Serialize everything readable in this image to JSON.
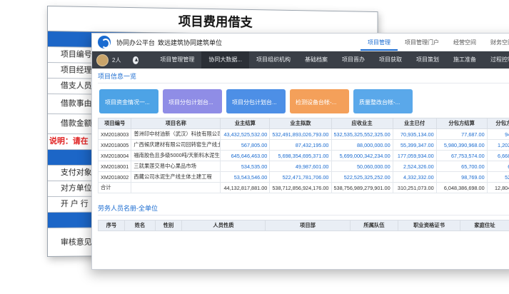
{
  "bg_form": {
    "title": "项目费用借支",
    "top_blue_label": "基本信息",
    "rows_top": [
      "项目编号",
      "项目经理",
      "借支人员",
      "借款事由",
      "借款金额"
    ],
    "note": "说明：请在",
    "rows_bottom": [
      "支付对象",
      "对方单位",
      "开 户 行"
    ],
    "review": "审核意见"
  },
  "window": {
    "app_name": "协同办公平台",
    "org_name": "致远建筑协同建筑单位",
    "top_tabs": [
      "项目管理",
      "项目管理门户",
      "经营空间",
      "财务空间"
    ],
    "user_count": "2人",
    "nav_items": [
      "项目管理管理",
      "协同大数据...",
      "项目组织机构",
      "基础档案",
      "项目晋办",
      "项目获取",
      "项目策划",
      "施工准备",
      "过程控制"
    ],
    "section1_title": "项目信息一览",
    "cards": [
      {
        "label": "项目资金情况一...",
        "color": "#4da3e6"
      },
      {
        "label": "项目分包计划台...",
        "color": "#8f8de6"
      },
      {
        "label": "项目分包计划台...",
        "color": "#4d8fe6"
      },
      {
        "label": "检测设备台帐-...",
        "color": "#f4a05a"
      },
      {
        "label": "质量整改台帐-...",
        "color": "#5aa8ea"
      }
    ],
    "table1": {
      "headers": [
        "项目编号",
        "项目名称",
        "业主结算",
        "业主拟款",
        "应收业主",
        "业主已付",
        "分包方结算",
        "分包方拟款",
        "应付分"
      ],
      "rows": [
        [
          "XM2018003",
          "普洲印中材油新（武汉）科技有限公司...",
          "43,432,525,532.00",
          "532,491,893,026,793.00",
          "532,535,325,552,325.00",
          "70,935,134.00",
          "77,687.00",
          "94,320.00",
          "-16,63"
        ],
        [
          "XM2018005",
          "广西候庆建材有限公司回转窑生产线土...",
          "567,805.00",
          "87,432,195.00",
          "88,000,000.00",
          "55,399,347.00",
          "5,980,390,968.00",
          "1,202,434.00",
          "5,979,188,"
        ],
        [
          "XM2018004",
          "福南胶色且多级5000吨/天新料水泥生...",
          "645,646,463.00",
          "5,698,354,695,371.00",
          "5,699,000,342,234.00",
          "177,059,934.00",
          "67,753,574.00",
          "6,668,865.00",
          "60,804,"
        ],
        [
          "XM2018001",
          "三就果莲交易中心果品市场",
          "534,535.00",
          "49,987,601.00",
          "50,060,000.00",
          "2,524,326.00",
          "65,700.00",
          "6,661.00",
          "59,"
        ],
        [
          "XM2018002",
          "西藏公司水泥生产线主体土建工程",
          "53,543,546.00",
          "522,471,781,706.00",
          "522,525,325,252.00",
          "4,332,332.00",
          "98,769.00",
          "52,920.00",
          "45,"
        ]
      ],
      "total": [
        "合计",
        "",
        "44,132,817,881.00",
        "538,712,856,924,176.00",
        "538,756,989,279,901.00",
        "310,251,073.00",
        "6,048,386,698.00",
        "12,804,657.00",
        "6,035,582,"
      ]
    },
    "section2_title": "劳务人员名册-全单位",
    "table2_headers": [
      "序号",
      "姓名",
      "性别",
      "人员性质",
      "项目部",
      "所属队伍",
      "职业资格证书",
      "家庭住址",
      "身份证号"
    ]
  }
}
